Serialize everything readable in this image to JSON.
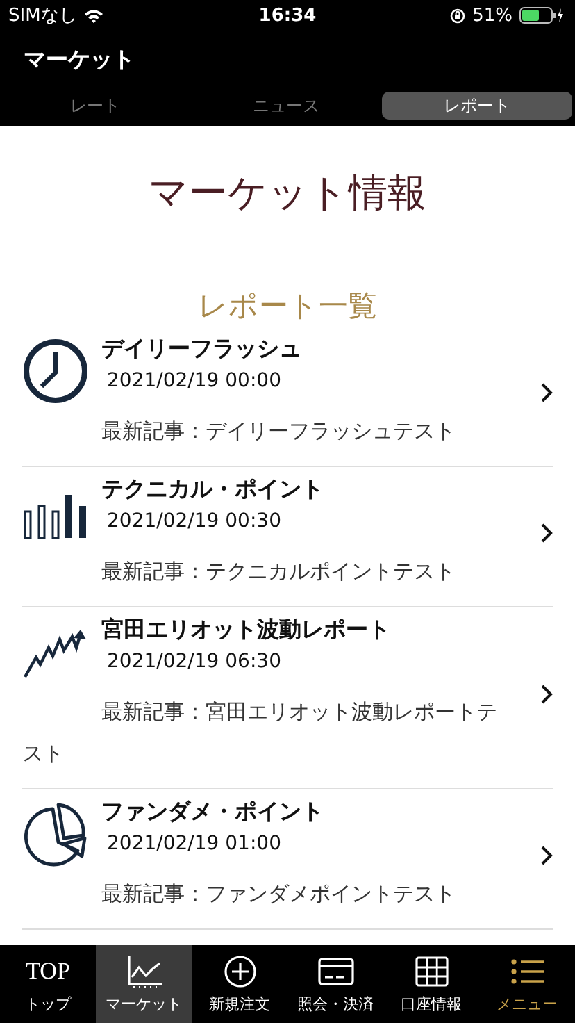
{
  "status_bar": {
    "carrier": "SIMなし",
    "time": "16:34",
    "battery": "51%"
  },
  "header": {
    "title": "マーケット"
  },
  "tabs": [
    {
      "label": "レート",
      "selected": false
    },
    {
      "label": "ニュース",
      "selected": false
    },
    {
      "label": "レポート",
      "selected": true
    }
  ],
  "page_title": "マーケット情報",
  "section_title": "レポート一覧",
  "reports": [
    {
      "kind": "clock",
      "title": "デイリーフラッシュ",
      "date": "2021/02/19 00:00",
      "latest": "最新記事：デイリーフラッシュテスト"
    },
    {
      "kind": "bars",
      "title": "テクニカル・ポイント",
      "date": "2021/02/19 00:30",
      "latest": "最新記事：テクニカルポイントテスト"
    },
    {
      "kind": "wave",
      "title": "宮田エリオット波動レポート",
      "date": "2021/02/19 06:30",
      "latest": "最新記事：宮田エリオット波動レポートテスト"
    },
    {
      "kind": "pie",
      "title": "ファンダメ・ポイント",
      "date": "2021/02/19 01:00",
      "latest": "最新記事：ファンダメポイントテスト"
    }
  ],
  "bottom_nav": [
    {
      "kind": "text",
      "icon_text": "TOP",
      "label": "トップ",
      "selected": false,
      "highlighted": false
    },
    {
      "kind": "chart",
      "label": "マーケット",
      "selected": true,
      "highlighted": false
    },
    {
      "kind": "plus",
      "label": "新規注文",
      "selected": false,
      "highlighted": false
    },
    {
      "kind": "card",
      "label": "照会・決済",
      "selected": false,
      "highlighted": false
    },
    {
      "kind": "grid",
      "label": "口座情報",
      "selected": false,
      "highlighted": false
    },
    {
      "kind": "list",
      "label": "メニュー",
      "selected": false,
      "highlighted": true
    }
  ]
}
